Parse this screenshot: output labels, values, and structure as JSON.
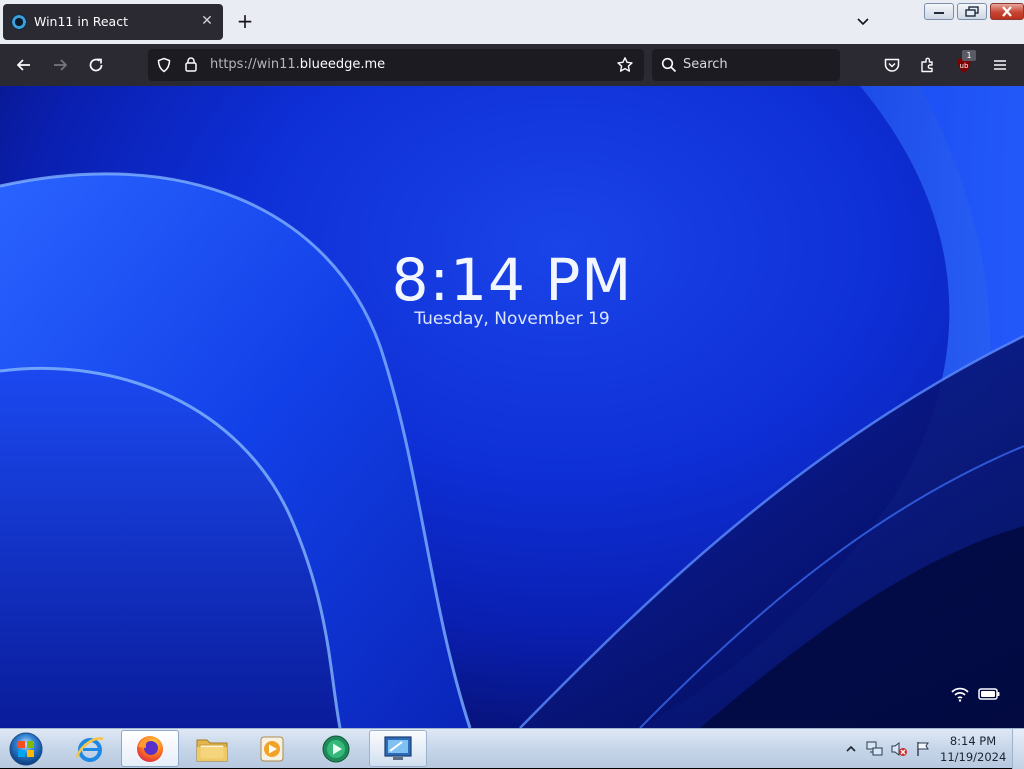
{
  "browser": {
    "tab": {
      "title": "Win11 in React"
    },
    "url": {
      "prefix": "https://win11.",
      "domain": "blueedge.me"
    },
    "search": {
      "placeholder": "Search"
    },
    "extension_badge": "1"
  },
  "lockscreen": {
    "time": "8:14 PM",
    "date": "Tuesday, November 19"
  },
  "taskbar": {
    "apps": [
      "start-orb",
      "internet-explorer",
      "firefox",
      "file-explorer",
      "media-player",
      "media-center",
      "remote-desktop"
    ],
    "clock_time": "8:14 PM",
    "clock_date": "11/19/2024"
  },
  "colors": {
    "browser_chrome": "#2b2a33",
    "tabstrip": "#e9ecf2",
    "wallpaper_blue": "#0e2fd6",
    "taskbar": "#c8d7ea"
  }
}
